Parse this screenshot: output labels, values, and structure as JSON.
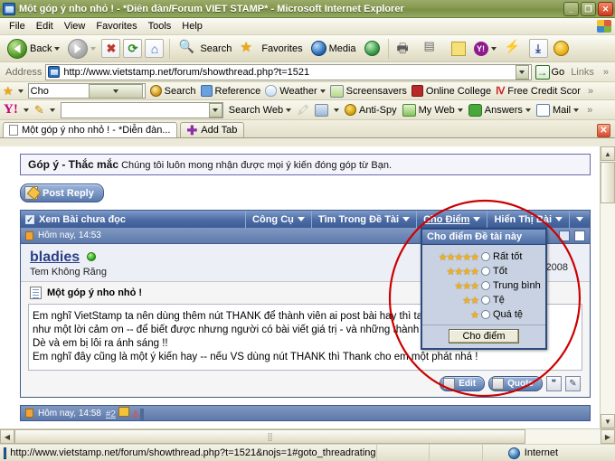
{
  "window": {
    "title": "Một góp ý nho nhỏ ! - *Diễn đàn/Forum VIET STAMP* - Microsoft Internet Explorer",
    "minimize": "_",
    "maximize": "❐",
    "close": "✕"
  },
  "menubar": {
    "items": [
      "File",
      "Edit",
      "View",
      "Favorites",
      "Tools",
      "Help"
    ]
  },
  "toolbar": {
    "back_label": "Back",
    "stop_label": "✖",
    "refresh_label": "⟳",
    "home_label": "⌂",
    "search_label": "Search",
    "favorites_label": "Favorites",
    "media_label": "Media",
    "history_label": "◴",
    "print_label": "🖶",
    "edit_label": "✎",
    "notes_label": "▭",
    "yahoo_label": "Y!",
    "messenger_label": "⚡",
    "download_label": "⤓",
    "emoticon_label": "☺"
  },
  "address": {
    "label": "Address",
    "url": "http://www.vietstamp.net/forum/showthread.php?t=1521",
    "go_label": "Go",
    "links_label": "Links",
    "overflow": "»"
  },
  "toolbar_yahoo1": {
    "search_value": "Cho",
    "items": [
      {
        "label": "Search",
        "icon": "target-icon"
      },
      {
        "label": "Reference",
        "icon": "book-icon"
      },
      {
        "label": "Weather",
        "icon": "cloud-icon",
        "caret": true
      },
      {
        "label": "Screensavers",
        "icon": "screensaver-icon"
      },
      {
        "label": "Online College",
        "icon": "graduation-cap-icon"
      },
      {
        "label": "Free Credit Scor",
        "icon": "chart-icon"
      }
    ],
    "overflow": "»"
  },
  "toolbar_yahoo2": {
    "logo": "Y!",
    "search_placeholder": "",
    "search_web_label": "Search Web",
    "items": [
      {
        "label": "Anti-Spy",
        "icon": "antispy-icon"
      },
      {
        "label": "My Web",
        "icon": "myweb-icon",
        "caret": true
      },
      {
        "label": "Answers",
        "icon": "answers-icon",
        "caret": true
      },
      {
        "label": "Mail",
        "icon": "mail-icon",
        "caret": true
      }
    ],
    "overflow": "»"
  },
  "tabs": {
    "items": [
      {
        "label": "Một góp ý nho nhỏ ! - *Diễn đàn...",
        "active": true
      }
    ],
    "add_tab_label": "Add Tab",
    "close_label": "✕"
  },
  "page": {
    "notice_title": "Góp ý - Thắc mắc",
    "notice_text": "Chúng tôi luôn mong nhận được mọi ý kiến đóng góp từ Bạn.",
    "post_reply_label": "Post Reply",
    "forum_bar": {
      "unread_label": "Xem Bài chưa đọc",
      "tools_label": "Công Cụ",
      "search_thread_label": "Tìm Trong Đề Tài",
      "rate_label": "Cho Điểm",
      "display_label": "Hiển Thị Bài",
      "more_label": "▼"
    },
    "post": {
      "date": "Hôm nay, 14:53",
      "username": "bladies",
      "user_title": "Tem Không Răng",
      "post_date_right": "-2008",
      "subject": "Một góp ý nho nhỏ !",
      "body_lines": [
        "Em nghĩ VietStamp ta nên dùng thêm nút THANK để thành viên ai post bài hay thì ta bấm vào đó xem",
        "như một lời cảm ơn -- để biết được nhưng người có bài viết giá trị - và những thành viên chỉ biết Ẩn Mình",
        "Dè và em bị lôi ra ánh sáng !!",
        "Em nghĩ đây cũng là một ý kiến hay -- nếu VS dùng nút THANK thì Thank cho em một phát nhá !"
      ],
      "edit_label": "Edit",
      "quote_label": "Quote",
      "multiquote_label": "❞",
      "reply_label": "✎"
    },
    "post2": {
      "date": "Hôm nay, 14:58",
      "number": "#2"
    }
  },
  "rating_menu": {
    "title": "Cho điểm Đề tài này",
    "options": [
      {
        "stars": "★★★★★",
        "label": "Rất tốt",
        "selected": false
      },
      {
        "stars": "★★★★",
        "label": "Tốt",
        "selected": false
      },
      {
        "stars": "★★★",
        "label": "Trung bình",
        "selected": false
      },
      {
        "stars": "★★",
        "label": "Tệ",
        "selected": false
      },
      {
        "stars": "★",
        "label": "Quá tệ",
        "selected": false
      }
    ],
    "submit_label": "Cho điểm"
  },
  "statusbar": {
    "url": "http://www.vietstamp.net/forum/showthread.php?t=1521&nojs=1#goto_threadrating",
    "zone": "Internet"
  },
  "colors": {
    "title_bar": "#869a4f",
    "forum_blue": "#4b6ba4",
    "accent_red": "#cc0000",
    "link_blue": "#2b3f87",
    "star_gold": "#f2b01c"
  }
}
